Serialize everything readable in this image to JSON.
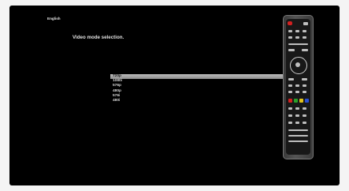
{
  "screen": {
    "language_label": "English",
    "title": "Video mode selection.",
    "options": [
      "720p",
      "1080i",
      "576p",
      "480p",
      "576i",
      "480i"
    ],
    "selected_index": 0
  },
  "remote": {
    "power_color": "#d32020",
    "color_keys": [
      "#d32020",
      "#2aa02a",
      "#e2c21a",
      "#2a4fd0"
    ]
  }
}
